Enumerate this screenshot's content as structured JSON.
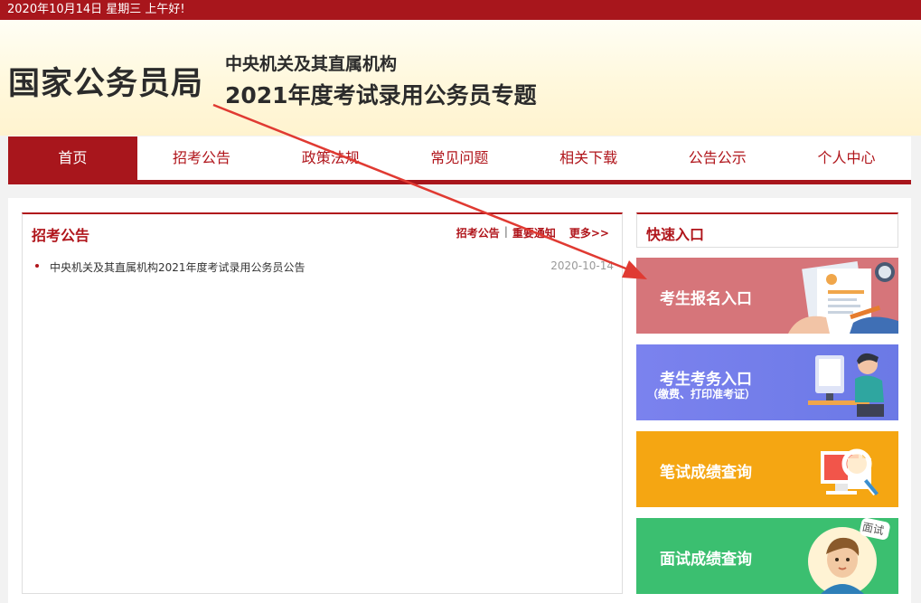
{
  "topbar": {
    "text": "2020年10月14日  星期三  上午好!"
  },
  "header": {
    "logo": "国家公务员局",
    "subtitle1": "中央机关及其直属机构",
    "subtitle2": "2021年度考试录用公务员专题"
  },
  "nav": {
    "items": [
      "首页",
      "招考公告",
      "政策法规",
      "常见问题",
      "相关下载",
      "公告公示",
      "个人中心"
    ]
  },
  "notices": {
    "title": "招考公告",
    "tab1": "招考公告",
    "separator": "|",
    "tab2": "重要通知",
    "more": "更多>>",
    "items": [
      {
        "title": "中央机关及其直属机构2021年度考试录用公务员公告",
        "date": "2020-10-14"
      }
    ]
  },
  "quick": {
    "title": "快速入口",
    "buttons": [
      {
        "label": "考生报名入口"
      },
      {
        "label": "考生考务入口",
        "sublabel": "（缴费、打印准考证）"
      },
      {
        "label": "笔试成绩查询"
      },
      {
        "label": "面试成绩查询",
        "badge": "面试"
      }
    ]
  },
  "colors": {
    "brand_red": "#a8161c",
    "btn_register": "#d6757a",
    "btn_exam": "#6b79e6",
    "btn_written": "#f5a612",
    "btn_interview": "#3bbf70"
  }
}
